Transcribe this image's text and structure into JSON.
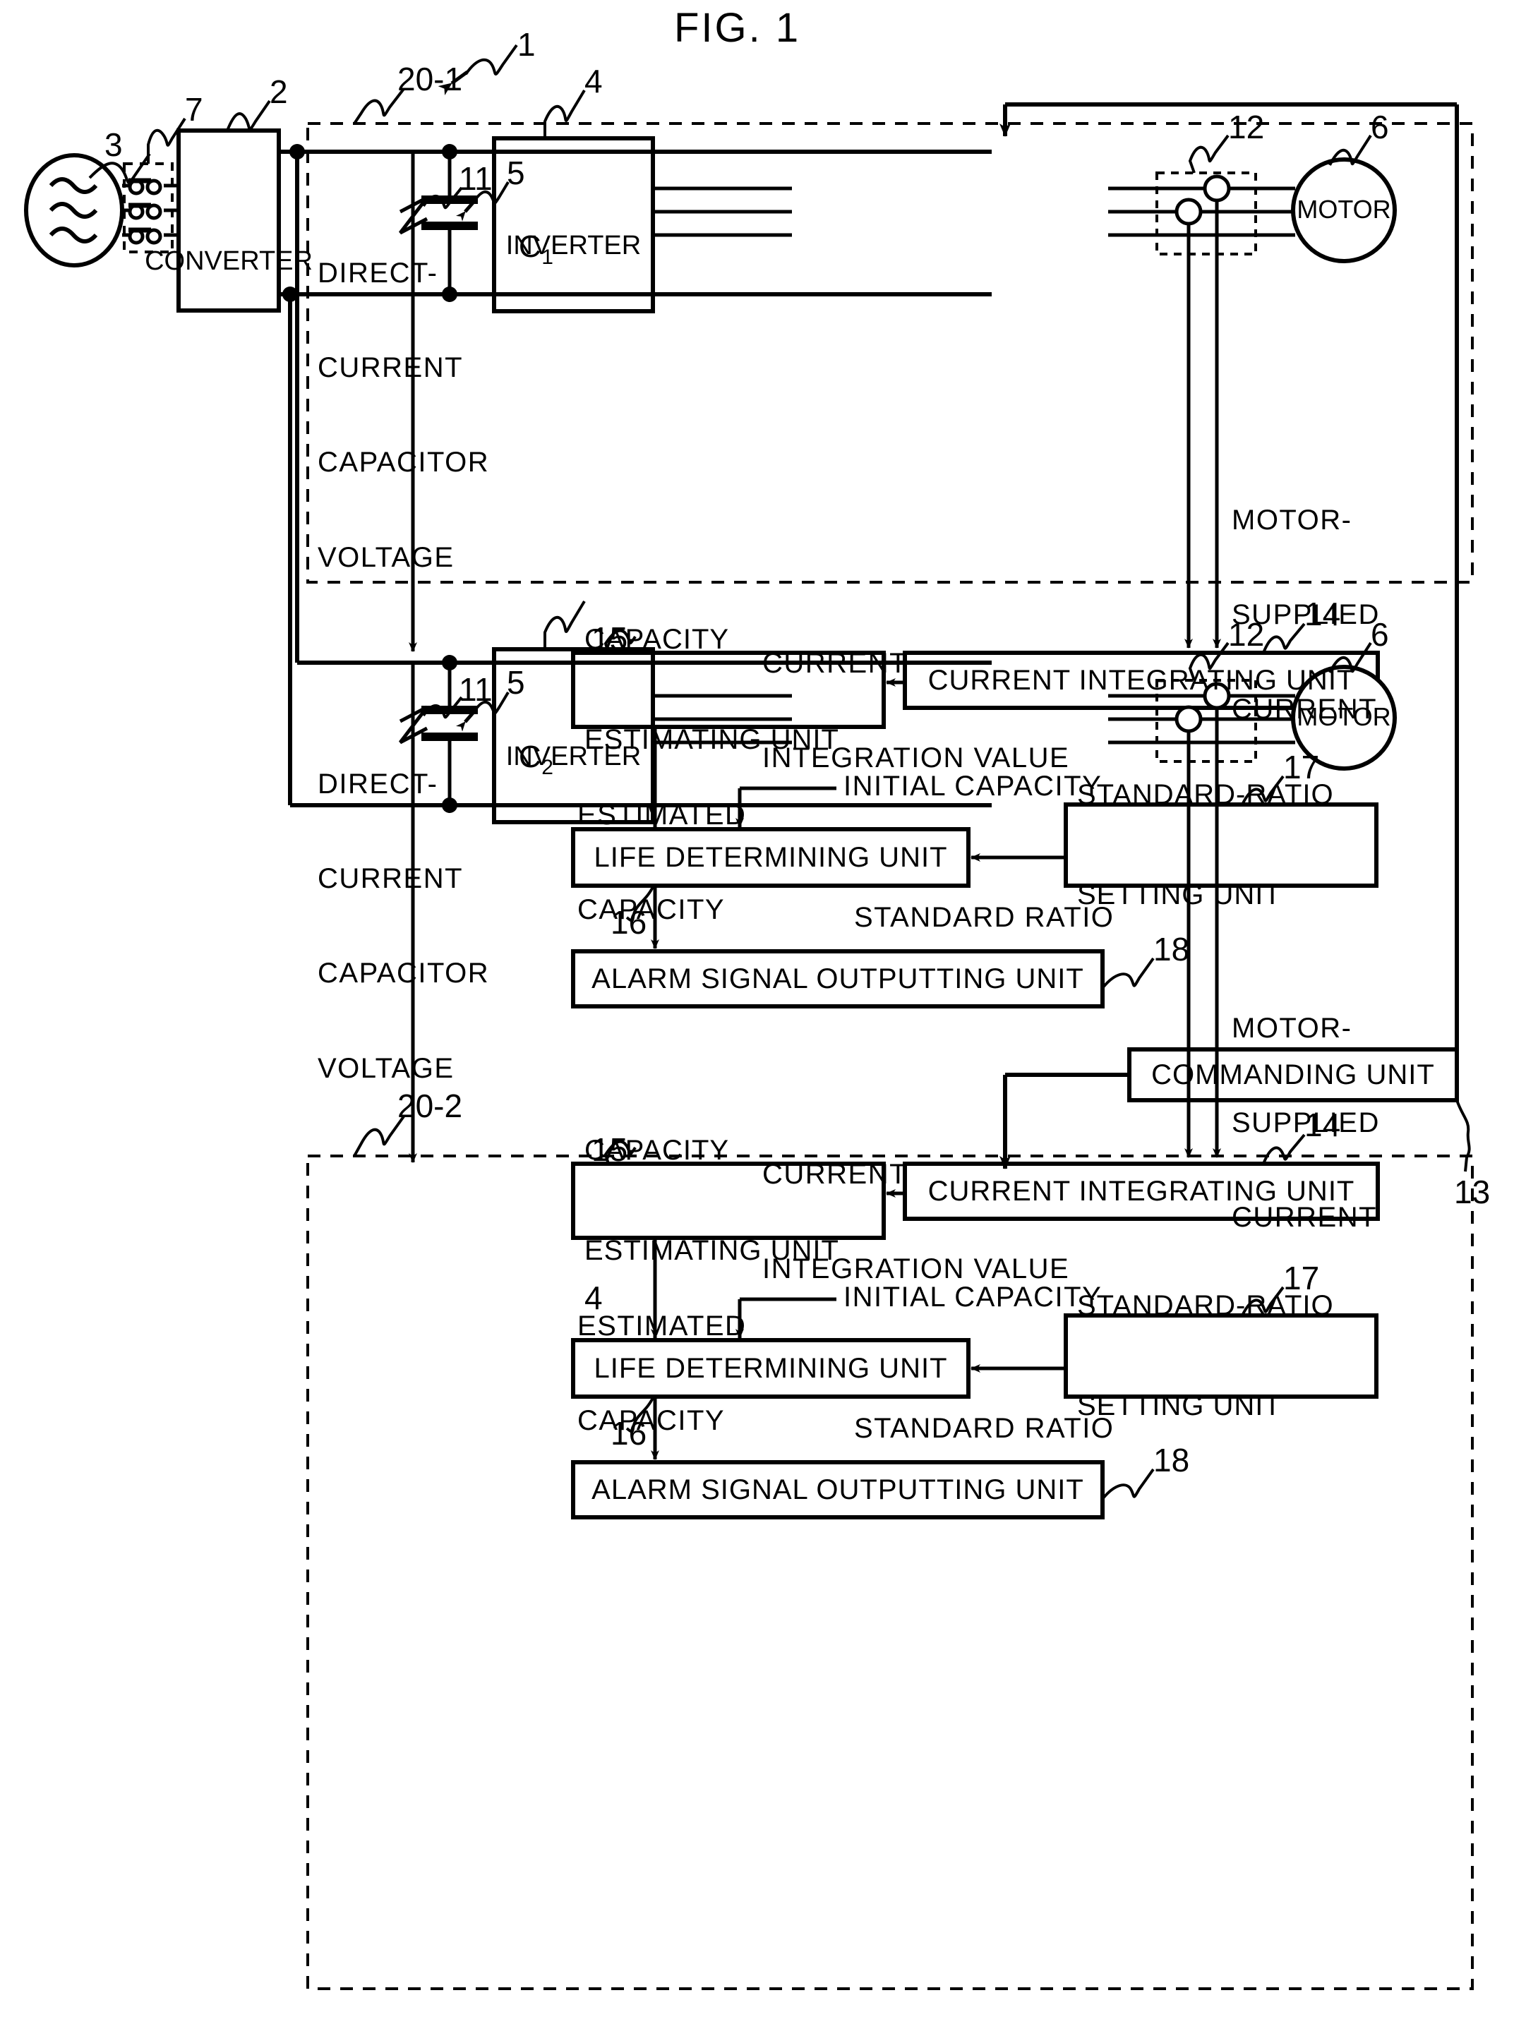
{
  "figure": {
    "title": "FIG. 1",
    "system_ref": "1"
  },
  "refs": {
    "system": "1",
    "converter": "2",
    "ac_source": "3",
    "inverter": "4",
    "capacitor": "5",
    "motor": "6",
    "contactor": "7",
    "dc_voltage_tap": "11",
    "current_sensor": "12",
    "commanding_unit": "13",
    "current_integrating_unit": "14",
    "capacity_estimating_unit": "15",
    "life_determining_unit": "16",
    "standard_ratio_setting_unit": "17",
    "alarm_signal_outputting_unit": "18",
    "drive_unit_1": "20-1",
    "drive_unit_2": "20-2"
  },
  "blocks": {
    "converter": "CONVERTER",
    "inverter": "INVERTER",
    "motor": "MOTOR",
    "commanding_unit": "COMMANDING UNIT",
    "current_integrating_unit": "CURRENT INTEGRATING UNIT",
    "capacity_estimating_unit_line1": "CAPACITY",
    "capacity_estimating_unit_line2": "ESTIMATING UNIT",
    "life_determining_unit": "LIFE DETERMINING UNIT",
    "standard_ratio_setting_unit_line1": "STANDARD-RATIO",
    "standard_ratio_setting_unit_line2": "SETTING UNIT",
    "alarm_signal_outputting_unit": "ALARM SIGNAL OUTPUTTING UNIT"
  },
  "signals": {
    "dc_capacitor_voltage_line1": "DIRECT-",
    "dc_capacitor_voltage_line2": "CURRENT",
    "dc_capacitor_voltage_line3": "CAPACITOR",
    "dc_capacitor_voltage_line4": "VOLTAGE",
    "motor_supplied_current_line1": "MOTOR-",
    "motor_supplied_current_line2": "SUPPLIED",
    "motor_supplied_current_line3": "CURRENT",
    "current_integration_value_line1": "CURRENT",
    "current_integration_value_line2": "INTEGRATION VALUE",
    "estimated_capacity_line1": "ESTIMATED",
    "estimated_capacity_line2": "CAPACITY",
    "initial_capacity": "INITIAL CAPACITY",
    "standard_ratio": "STANDARD RATIO"
  },
  "capacitors": {
    "unit1_symbol": "C",
    "unit1_subscript": "1",
    "unit2_symbol": "C",
    "unit2_subscript": "2"
  },
  "colors": {
    "line": "#000000",
    "background": "#ffffff"
  }
}
